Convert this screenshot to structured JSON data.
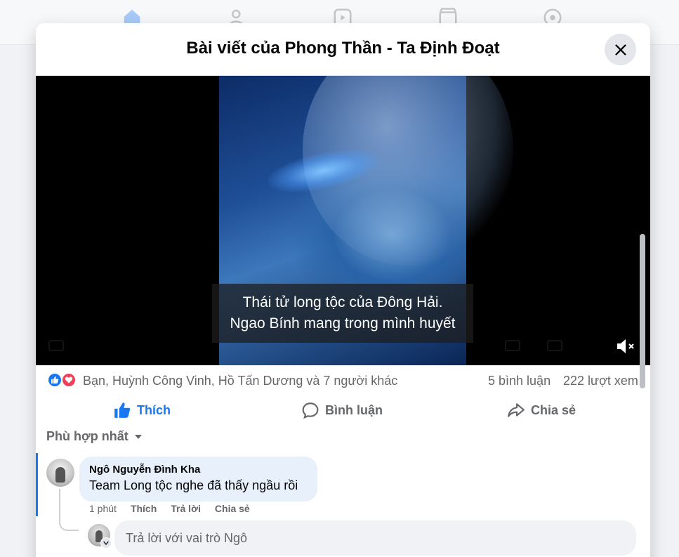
{
  "post": {
    "title": "Bài viết của Phong Thần - Ta Định Đoạt"
  },
  "video": {
    "subtitle_line1": "Thái tử long tộc của Đông Hải.",
    "subtitle_line2": "Ngao Bính mang trong mình huyết"
  },
  "stats": {
    "reactions_text": "Bạn, Huỳnh Công Vinh, Hồ Tấn Dương và 7 người khác",
    "comments": "5 bình luận",
    "views": "222 lượt xem"
  },
  "actions": {
    "like": "Thích",
    "comment": "Bình luận",
    "share": "Chia sẻ"
  },
  "sort": {
    "label": "Phù hợp nhất"
  },
  "comment": {
    "author": "Ngô Nguyễn Đình Kha",
    "text": "Team Long tộc nghe đã thấy ngầu rồi",
    "time": "1 phút",
    "like": "Thích",
    "reply": "Trả lời",
    "share": "Chia sẻ"
  },
  "reply": {
    "placeholder": "Trả lời với vai trò Ngô"
  },
  "colors": {
    "accent": "#1877f2",
    "love": "#f33e58",
    "bubble": "#e7f0fb"
  },
  "icons": [
    "home-icon",
    "friends-icon",
    "video-icon",
    "marketplace-icon",
    "gaming-icon",
    "close-icon",
    "mute-icon",
    "like-icon",
    "comment-icon",
    "share-icon",
    "chevron-down-icon"
  ]
}
